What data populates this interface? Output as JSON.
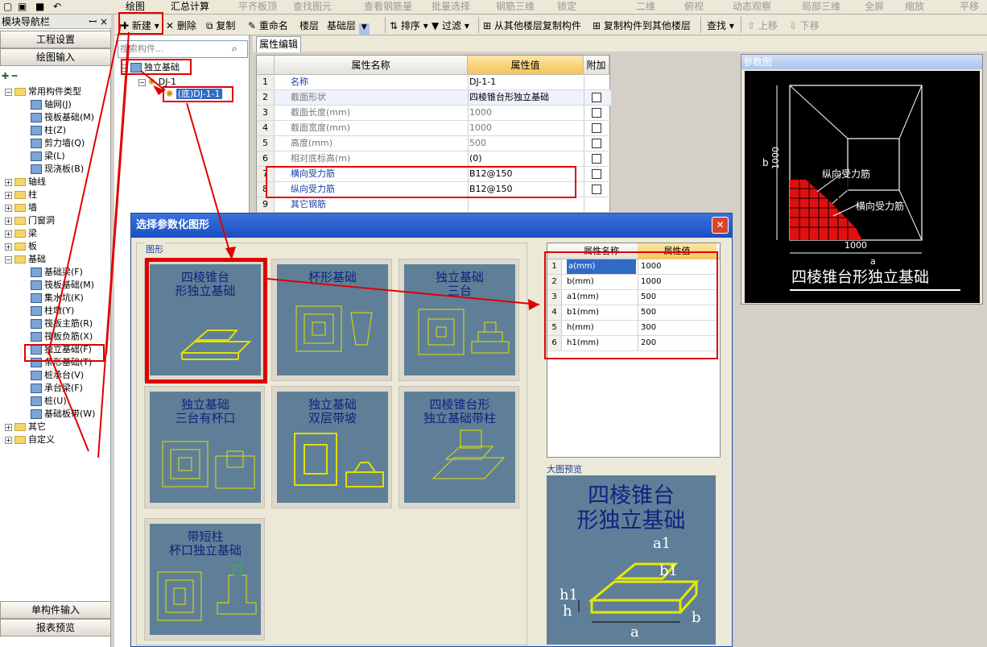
{
  "top_toolbar": {
    "draw": "绘图",
    "sum": "汇总计算",
    "flat_slab": "平齐板顶",
    "find_elem": "查找图元",
    "view_rebar": "查看钢筋量",
    "batch_select": "批量选择",
    "rebar_3d": "钢筋三维",
    "lock": "锁定",
    "two_d": "二维",
    "top_view": "俯视",
    "dynamic": "动态观察",
    "local_3d": "局部三维",
    "fullscreen": "全屏",
    "zoom": "缩放",
    "pan": "平移"
  },
  "nav": {
    "title": "模块导航栏",
    "pin": "ꟷ ×",
    "project_settings": "工程设置",
    "draw_input": "绘图输入",
    "single_input": "单构件输入",
    "report_preview": "报表预览",
    "tree": [
      {
        "label": "常用构件类型",
        "level": 0,
        "type": "folder-open"
      },
      {
        "label": "轴网(J)",
        "level": 1,
        "type": "item"
      },
      {
        "label": "筏板基础(M)",
        "level": 1,
        "type": "item"
      },
      {
        "label": "柱(Z)",
        "level": 1,
        "type": "item"
      },
      {
        "label": "剪力墙(Q)",
        "level": 1,
        "type": "item"
      },
      {
        "label": "梁(L)",
        "level": 1,
        "type": "item"
      },
      {
        "label": "现浇板(B)",
        "level": 1,
        "type": "item"
      },
      {
        "label": "轴线",
        "level": 0,
        "type": "folder"
      },
      {
        "label": "柱",
        "level": 0,
        "type": "folder"
      },
      {
        "label": "墙",
        "level": 0,
        "type": "folder"
      },
      {
        "label": "门窗洞",
        "level": 0,
        "type": "folder"
      },
      {
        "label": "梁",
        "level": 0,
        "type": "folder"
      },
      {
        "label": "板",
        "level": 0,
        "type": "folder"
      },
      {
        "label": "基础",
        "level": 0,
        "type": "folder-open"
      },
      {
        "label": "基础梁(F)",
        "level": 1,
        "type": "item"
      },
      {
        "label": "筏板基础(M)",
        "level": 1,
        "type": "item"
      },
      {
        "label": "集水坑(K)",
        "level": 1,
        "type": "item"
      },
      {
        "label": "柱墩(Y)",
        "level": 1,
        "type": "item"
      },
      {
        "label": "筏板主筋(R)",
        "level": 1,
        "type": "item"
      },
      {
        "label": "筏板负筋(X)",
        "level": 1,
        "type": "item"
      },
      {
        "label": "独立基础(F)",
        "level": 1,
        "type": "item"
      },
      {
        "label": "条形基础(T)",
        "level": 1,
        "type": "item"
      },
      {
        "label": "桩承台(V)",
        "level": 1,
        "type": "item"
      },
      {
        "label": "承台梁(F)",
        "level": 1,
        "type": "item"
      },
      {
        "label": "桩(U)",
        "level": 1,
        "type": "item"
      },
      {
        "label": "基础板带(W)",
        "level": 1,
        "type": "item"
      },
      {
        "label": "其它",
        "level": 0,
        "type": "folder"
      },
      {
        "label": "自定义",
        "level": 0,
        "type": "folder"
      }
    ]
  },
  "main_toolbar": {
    "new": "新建",
    "delete": "删除",
    "copy": "复制",
    "rename": "重命名",
    "floor": "楼层",
    "floor_value": "基础层",
    "sort": "排序",
    "filter": "过滤",
    "copy_from": "从其他楼层复制构件",
    "copy_to": "复制构件到其他楼层",
    "find": "查找",
    "up": "上移",
    "down": "下移"
  },
  "sidebar": {
    "search_placeholder": "搜索构件...",
    "root": "独立基础",
    "child": "DJ-1",
    "leaf": "(底)DJ-1-1"
  },
  "props": {
    "tab": "属性编辑",
    "col_name": "属性名称",
    "col_value": "属性值",
    "col_extra": "附加",
    "rows": [
      {
        "n": "1",
        "name": "名称",
        "value": "DJ-1-1",
        "blue": true
      },
      {
        "n": "2",
        "name": "截面形状",
        "value": "四棱锥台形独立基础",
        "blue": false
      },
      {
        "n": "3",
        "name": "截面长度(mm)",
        "value": "1000",
        "blue": false
      },
      {
        "n": "4",
        "name": "截面宽度(mm)",
        "value": "1000",
        "blue": false
      },
      {
        "n": "5",
        "name": "高度(mm)",
        "value": "500",
        "blue": false
      },
      {
        "n": "6",
        "name": "相对底标高(m)",
        "value": "(0)",
        "blue": false
      },
      {
        "n": "7",
        "name": "横向受力筋",
        "value": "B12@150",
        "blue": true
      },
      {
        "n": "8",
        "name": "纵向受力筋",
        "value": "B12@150",
        "blue": true
      },
      {
        "n": "9",
        "name": "其它钢筋",
        "value": "",
        "blue": true
      }
    ]
  },
  "param_preview": {
    "title": "参数图",
    "dim_b": "b",
    "dim_1000_v": "1000",
    "dim_1000_h": "1000",
    "dim_a": "a",
    "long_rebar": "纵向受力筋",
    "trans_rebar": "横向受力筋",
    "shape_name": "四棱锥台形独立基础"
  },
  "dialog": {
    "title": "选择参数化图形",
    "group_label": "图形",
    "big_preview_label": "大图预览",
    "close": "✕",
    "tiles": [
      {
        "title": "四棱锥台\n形独立基础"
      },
      {
        "title": "杯形基础"
      },
      {
        "title": "独立基础\n三台"
      },
      {
        "title": "独立基础\n三台有杯口"
      },
      {
        "title": "独立基础\n双层带坡"
      },
      {
        "title": "四棱锥台形\n独立基础带柱"
      },
      {
        "title": "带短柱\n杯口独立基础"
      }
    ],
    "param_header": {
      "name": "属性名称",
      "value": "属性值"
    },
    "params": [
      {
        "n": "1",
        "name": "a(mm)",
        "value": "1000"
      },
      {
        "n": "2",
        "name": "b(mm)",
        "value": "1000"
      },
      {
        "n": "3",
        "name": "a1(mm)",
        "value": "500"
      },
      {
        "n": "4",
        "name": "b1(mm)",
        "value": "500"
      },
      {
        "n": "5",
        "name": "h(mm)",
        "value": "300"
      },
      {
        "n": "6",
        "name": "h1(mm)",
        "value": "200"
      }
    ],
    "big_title": "四棱锥台\n形独立基础",
    "dims": {
      "a1": "a1",
      "b1": "b1",
      "h1": "h1",
      "h": "h",
      "a": "a",
      "b": "b"
    }
  },
  "colors": {
    "highlight": "#e00000",
    "title_blue": "#0f237e",
    "art_bg": "#5f7f98",
    "outline": "#e0e000"
  }
}
